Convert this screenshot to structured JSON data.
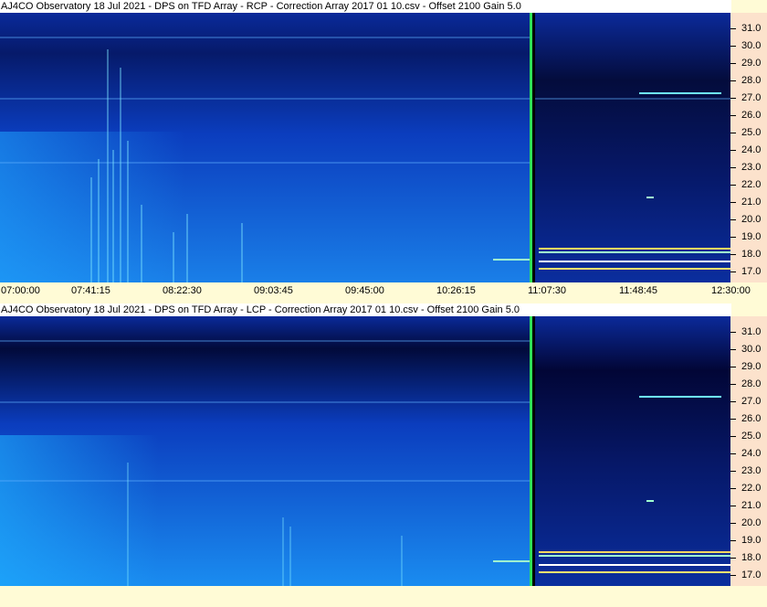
{
  "panels": [
    {
      "id": "rcp",
      "title": "AJ4CO Observatory 18 Jul 2021  -  DPS on TFD Array  -  RCP  -  Correction Array 2017 01 10.csv  -  Offset 2100  Gain 5.0"
    },
    {
      "id": "lcp",
      "title": "AJ4CO Observatory 18 Jul 2021  -  DPS on TFD Array  -  LCP  -  Correction Array 2017 01 10.csv  -  Offset 2100  Gain 5.0"
    }
  ],
  "y_axis_labels": [
    "31.0",
    "30.0",
    "29.0",
    "28.0",
    "27.0",
    "26.0",
    "25.0",
    "24.0",
    "23.0",
    "22.0",
    "21.0",
    "20.0",
    "19.0",
    "18.0",
    "17.0"
  ],
  "x_axis_labels": [
    "07:00:00",
    "07:41:15",
    "08:22:30",
    "09:03:45",
    "09:45:00",
    "10:26:15",
    "11:07:30",
    "11:48:45",
    "12:30:00"
  ],
  "colors": {
    "background": "#fffbd6",
    "axis_panel": "#fce2cc",
    "spectrogram_dark": "#000a3a",
    "spectrogram_mid": "#0a3cc8",
    "spectrogram_light": "#1aa0ff"
  }
}
